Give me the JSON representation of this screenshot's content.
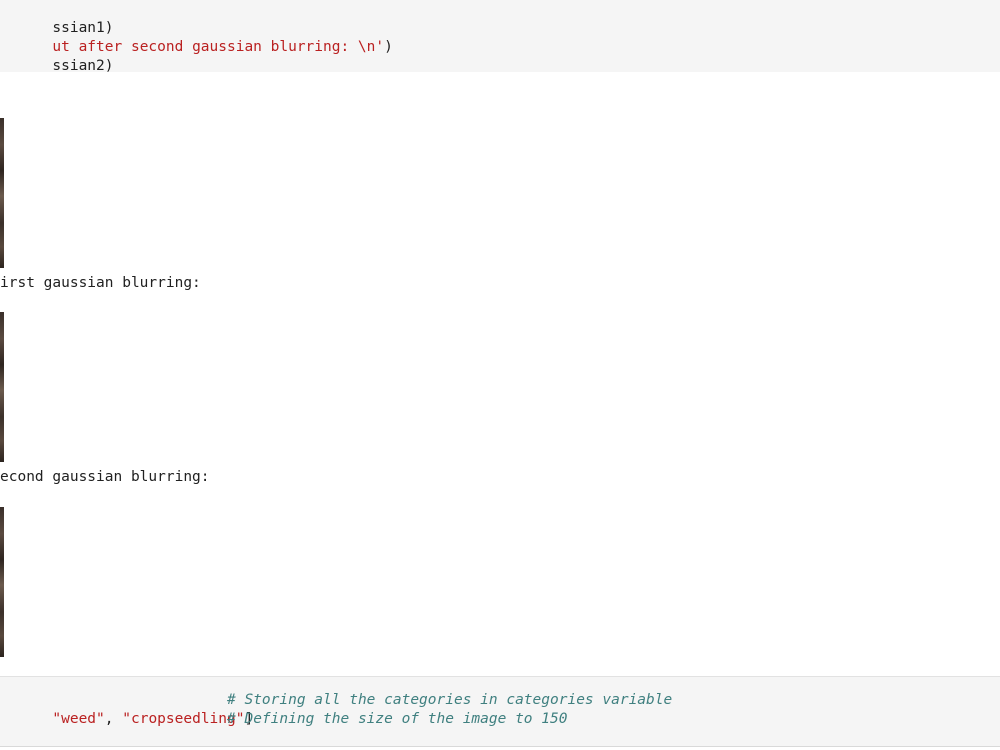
{
  "top_cell": {
    "lines": [
      {
        "parts": [
          {
            "t": "ssian1)",
            "c": "punct"
          }
        ]
      },
      {
        "parts": [
          {
            "t": "ut after second gaussian blurring: \\n'",
            "c": "str"
          },
          {
            "t": ")",
            "c": "punct"
          }
        ]
      },
      {
        "parts": [
          {
            "t": "ssian2)",
            "c": "punct"
          }
        ]
      }
    ]
  },
  "output": {
    "label_first": "irst gaussian blurring:",
    "label_second": "econd gaussian blurring:"
  },
  "bottom_cell": {
    "line1_str1": "\"weed\"",
    "line1_sep": ", ",
    "line1_str2": "\"cropseedling\"",
    "line1_close": "]",
    "line1_comment": "# Storing all the categories in categories variable",
    "line2_comment": "# Defining the size of the image to 150"
  }
}
